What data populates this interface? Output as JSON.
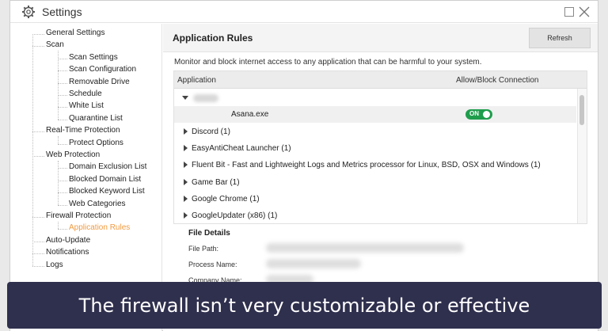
{
  "window": {
    "title": "Settings",
    "icons": {
      "app": "gear-icon",
      "maximize": "maximize-icon",
      "close": "close-icon"
    }
  },
  "sidebar": {
    "items": [
      {
        "label": "General Settings",
        "level": 0
      },
      {
        "label": "Scan",
        "level": 0
      },
      {
        "label": "Scan Settings",
        "level": 1
      },
      {
        "label": "Scan Configuration",
        "level": 1
      },
      {
        "label": "Removable Drive",
        "level": 1
      },
      {
        "label": "Schedule",
        "level": 1
      },
      {
        "label": "White List",
        "level": 1
      },
      {
        "label": "Quarantine List",
        "level": 1
      },
      {
        "label": "Real-Time Protection",
        "level": 0
      },
      {
        "label": "Protect Options",
        "level": 1
      },
      {
        "label": "Web Protection",
        "level": 0
      },
      {
        "label": "Domain Exclusion List",
        "level": 1
      },
      {
        "label": "Blocked Domain List",
        "level": 1
      },
      {
        "label": "Blocked Keyword List",
        "level": 1
      },
      {
        "label": "Web Categories",
        "level": 1
      },
      {
        "label": "Firewall Protection",
        "level": 0
      },
      {
        "label": "Application Rules",
        "level": 1,
        "active": true
      },
      {
        "label": "Auto-Update",
        "level": 0
      },
      {
        "label": "Notifications",
        "level": 0
      },
      {
        "label": "Logs",
        "level": 0
      }
    ]
  },
  "main": {
    "title": "Application Rules",
    "refresh_label": "Refresh",
    "description": "Monitor and block internet access to any application that can be harmful to your system.",
    "table": {
      "columns": [
        "Application",
        "Allow/Block Connection"
      ],
      "rows": [
        {
          "label": "",
          "expanded": true,
          "redacted": true
        },
        {
          "label": "Asana.exe",
          "child": true,
          "toggle": "ON"
        },
        {
          "label": "Discord (1)"
        },
        {
          "label": "EasyAntiCheat Launcher (1)"
        },
        {
          "label": "Fluent Bit - Fast and Lightweight Logs and Metrics processor for Linux, BSD, OSX and Windows (1)"
        },
        {
          "label": "Game Bar (1)"
        },
        {
          "label": "Google Chrome (1)"
        },
        {
          "label": "GoogleUpdater (x86) (1)"
        }
      ]
    },
    "details": {
      "title": "File Details",
      "labels": [
        "File Path:",
        "Process Name:",
        "Company Name:"
      ]
    }
  },
  "caption": "The firewall isn’t very customizable or effective",
  "colors": {
    "active": "#f29a3f",
    "toggle_on": "#1f9d4c",
    "caption_bg": "#2f2f4e"
  }
}
